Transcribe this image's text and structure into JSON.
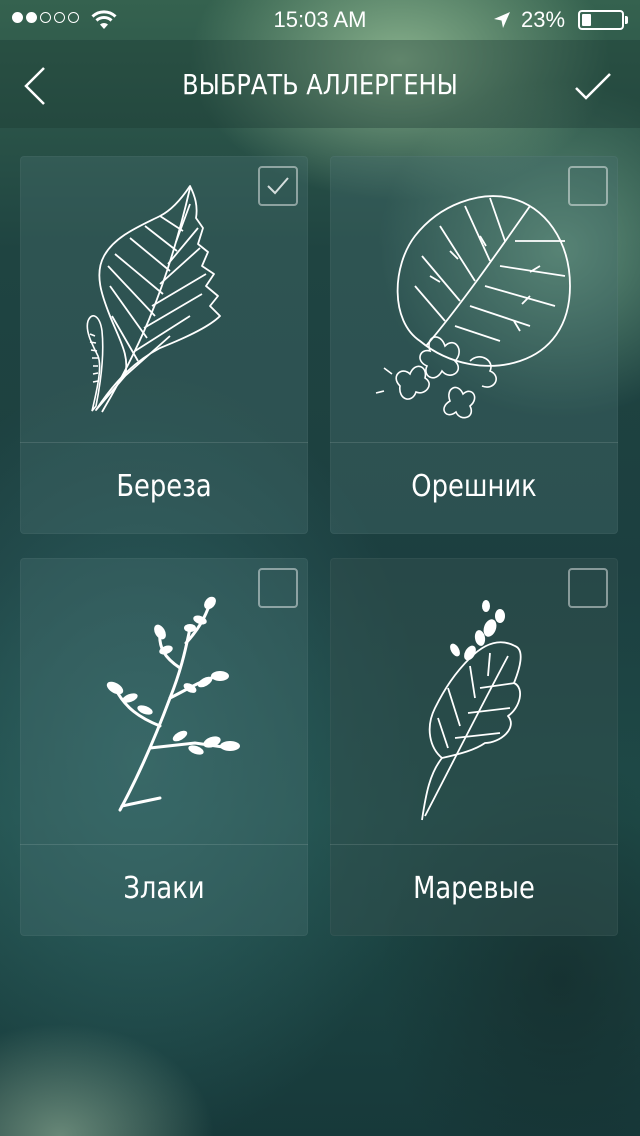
{
  "status_bar": {
    "signal_strength": 2,
    "time": "15:03 AM",
    "battery_percent": "23%",
    "battery_level": 0.23
  },
  "nav": {
    "title": "ВЫБРАТЬ АЛЛЕРГЕНЫ",
    "back_icon": "chevron-left-icon",
    "done_icon": "checkmark-icon"
  },
  "allergens": [
    {
      "label": "Береза",
      "checked": true,
      "icon": "birch-leaf-icon"
    },
    {
      "label": "Орешник",
      "checked": false,
      "icon": "hazel-leaf-icon"
    },
    {
      "label": "Злаки",
      "checked": false,
      "icon": "grass-icon"
    },
    {
      "label": "Маревые",
      "checked": false,
      "icon": "goosefoot-icon"
    }
  ]
}
